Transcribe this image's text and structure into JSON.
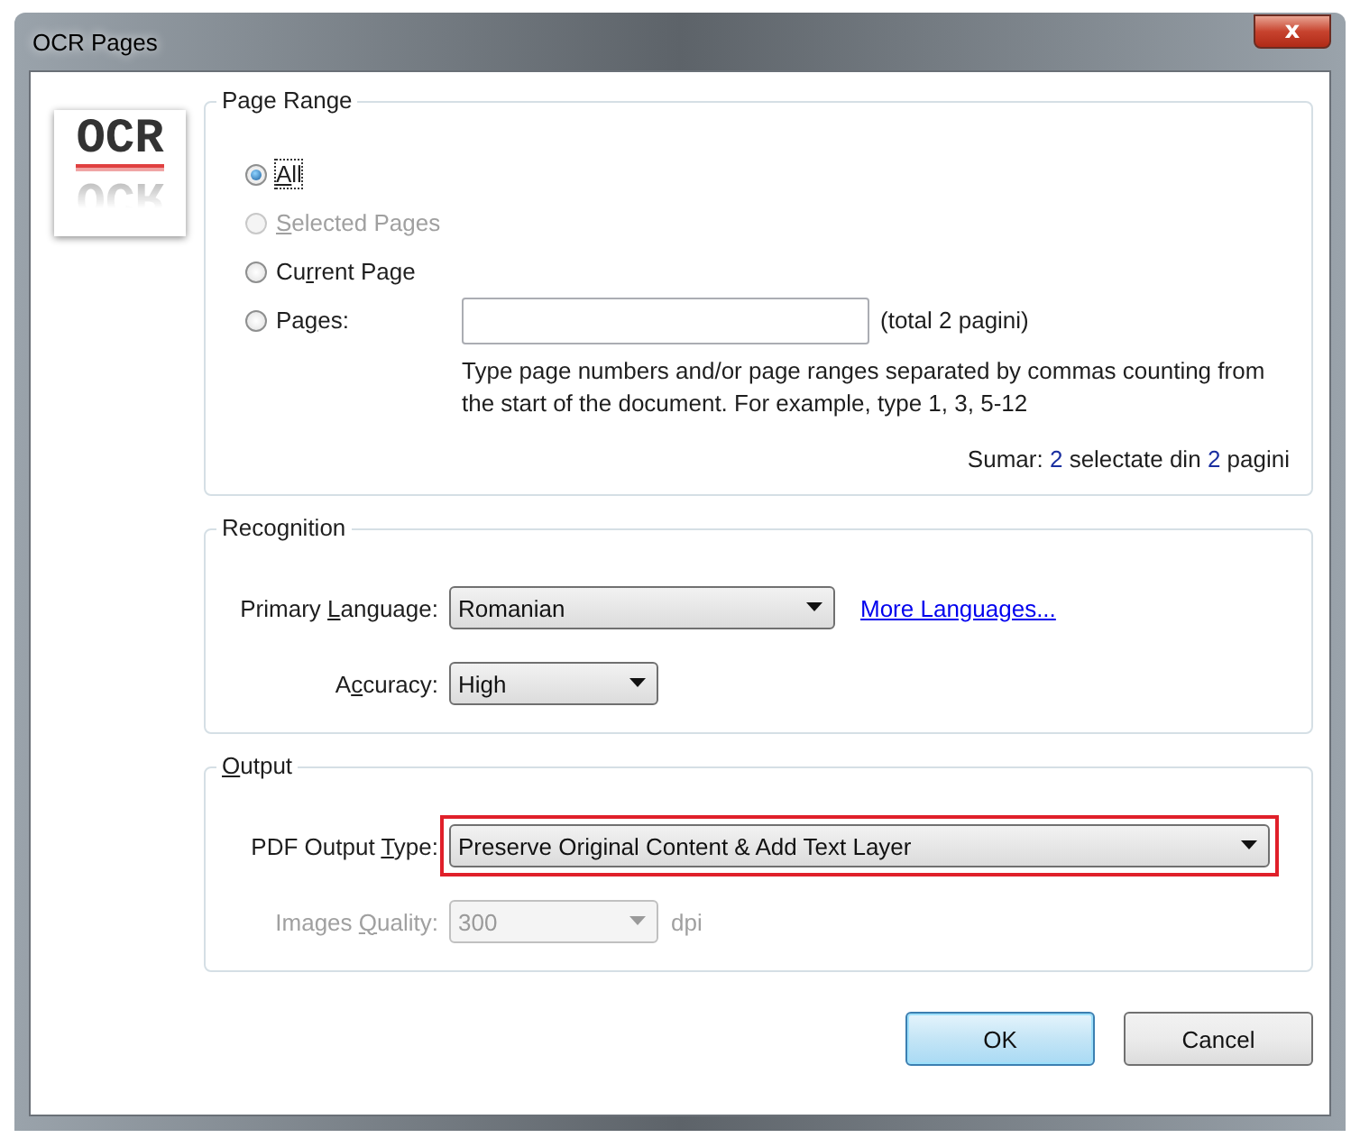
{
  "window": {
    "title": "OCR Pages",
    "close": "x"
  },
  "logo": {
    "text": "OCR"
  },
  "page_range": {
    "title": "Page Range",
    "options": [
      {
        "label": "All",
        "selected": true,
        "disabled": false
      },
      {
        "label": "Selected Pages",
        "selected": false,
        "disabled": true
      },
      {
        "label": "Current Page",
        "selected": false,
        "disabled": false
      },
      {
        "label": "Pages:",
        "selected": false,
        "disabled": false
      }
    ],
    "total": "(total 2 pagini)",
    "help": "Type page numbers and/or page ranges separated by commas counting from the start of the document. For example, type 1, 3, 5-12",
    "summary": [
      {
        "text": "Sumar:",
        "highlight": false
      },
      {
        "text": "2",
        "highlight": true
      },
      {
        "text": "selectate din",
        "highlight": false
      },
      {
        "text": "2",
        "highlight": true
      },
      {
        "text": "pagini",
        "highlight": false
      }
    ]
  },
  "recognition": {
    "title": "Recognition",
    "rows": [
      {
        "label": "Primary Language:",
        "value": "Romanian",
        "disabled": false,
        "highlighted": false,
        "link": "More Languages..."
      },
      {
        "label": "Accuracy:",
        "value": "High",
        "disabled": false,
        "highlighted": false
      }
    ]
  },
  "output": {
    "title": "Output",
    "rows": [
      {
        "label": "PDF Output Type:",
        "value": "Preserve Original Content & Add Text Layer",
        "disabled": false,
        "highlighted": true
      },
      {
        "label": "Images Quality:",
        "value": "300",
        "disabled": true,
        "highlighted": false,
        "after": "dpi"
      }
    ]
  },
  "buttons": [
    {
      "label": "OK",
      "default": true
    },
    {
      "label": "Cancel",
      "default": false
    }
  ]
}
